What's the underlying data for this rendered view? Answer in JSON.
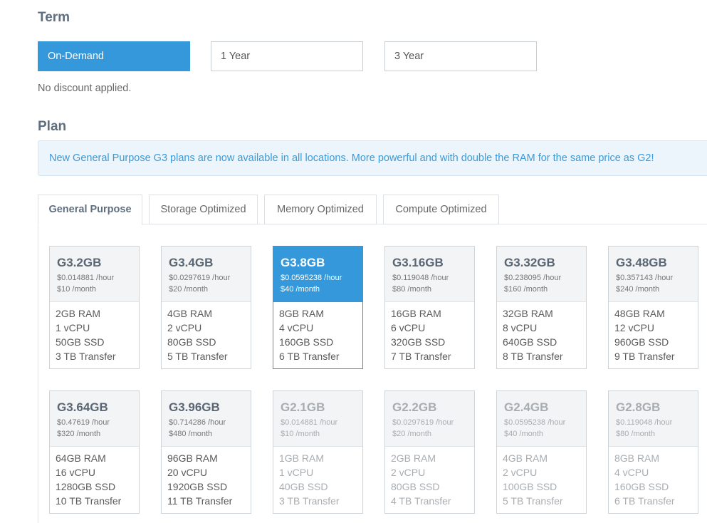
{
  "term": {
    "title": "Term",
    "options": [
      {
        "label": "On-Demand",
        "active": true
      },
      {
        "label": "1 Year",
        "active": false
      },
      {
        "label": "3 Year",
        "active": false
      }
    ],
    "discount_text": "No discount applied."
  },
  "plan": {
    "title": "Plan",
    "notice": "New General Purpose G3 plans are now available in all locations. More powerful and with double the RAM for the same price as G2!",
    "tabs": [
      {
        "label": "General Purpose",
        "active": true
      },
      {
        "label": "Storage Optimized",
        "active": false
      },
      {
        "label": "Memory Optimized",
        "active": false
      },
      {
        "label": "Compute Optimized",
        "active": false
      }
    ],
    "cards": [
      {
        "name": "G3.2GB",
        "hourly": "$0.014881 /hour",
        "monthly": "$10 /month",
        "ram": "2GB RAM",
        "cpu": "1 vCPU",
        "ssd": "50GB SSD",
        "transfer": "3 TB Transfer",
        "state": "normal"
      },
      {
        "name": "G3.4GB",
        "hourly": "$0.0297619 /hour",
        "monthly": "$20 /month",
        "ram": "4GB RAM",
        "cpu": "2 vCPU",
        "ssd": "80GB SSD",
        "transfer": "5 TB Transfer",
        "state": "normal"
      },
      {
        "name": "G3.8GB",
        "hourly": "$0.0595238 /hour",
        "monthly": "$40 /month",
        "ram": "8GB RAM",
        "cpu": "4 vCPU",
        "ssd": "160GB SSD",
        "transfer": "6 TB Transfer",
        "state": "selected"
      },
      {
        "name": "G3.16GB",
        "hourly": "$0.119048 /hour",
        "monthly": "$80 /month",
        "ram": "16GB RAM",
        "cpu": "6 vCPU",
        "ssd": "320GB SSD",
        "transfer": "7 TB Transfer",
        "state": "normal"
      },
      {
        "name": "G3.32GB",
        "hourly": "$0.238095 /hour",
        "monthly": "$160 /month",
        "ram": "32GB RAM",
        "cpu": "8 vCPU",
        "ssd": "640GB SSD",
        "transfer": "8 TB Transfer",
        "state": "normal"
      },
      {
        "name": "G3.48GB",
        "hourly": "$0.357143 /hour",
        "monthly": "$240 /month",
        "ram": "48GB RAM",
        "cpu": "12 vCPU",
        "ssd": "960GB SSD",
        "transfer": "9 TB Transfer",
        "state": "normal"
      },
      {
        "name": "G3.64GB",
        "hourly": "$0.47619 /hour",
        "monthly": "$320 /month",
        "ram": "64GB RAM",
        "cpu": "16 vCPU",
        "ssd": "1280GB SSD",
        "transfer": "10 TB Transfer",
        "state": "normal"
      },
      {
        "name": "G3.96GB",
        "hourly": "$0.714286 /hour",
        "monthly": "$480 /month",
        "ram": "96GB RAM",
        "cpu": "20 vCPU",
        "ssd": "1920GB SSD",
        "transfer": "11 TB Transfer",
        "state": "normal"
      },
      {
        "name": "G2.1GB",
        "hourly": "$0.014881 /hour",
        "monthly": "$10 /month",
        "ram": "1GB RAM",
        "cpu": "1 vCPU",
        "ssd": "40GB SSD",
        "transfer": "3 TB Transfer",
        "state": "legacy"
      },
      {
        "name": "G2.2GB",
        "hourly": "$0.0297619 /hour",
        "monthly": "$20 /month",
        "ram": "2GB RAM",
        "cpu": "2 vCPU",
        "ssd": "80GB SSD",
        "transfer": "4 TB Transfer",
        "state": "legacy"
      },
      {
        "name": "G2.4GB",
        "hourly": "$0.0595238 /hour",
        "monthly": "$40 /month",
        "ram": "4GB RAM",
        "cpu": "2 vCPU",
        "ssd": "100GB SSD",
        "transfer": "5 TB Transfer",
        "state": "legacy"
      },
      {
        "name": "G2.8GB",
        "hourly": "$0.119048 /hour",
        "monthly": "$80 /month",
        "ram": "8GB RAM",
        "cpu": "4 vCPU",
        "ssd": "160GB SSD",
        "transfer": "6 TB Transfer",
        "state": "legacy"
      }
    ]
  },
  "colors": {
    "accent": "#3498db",
    "notice_bg": "#ecf5fb",
    "legacy_text": "#a8adb2"
  }
}
